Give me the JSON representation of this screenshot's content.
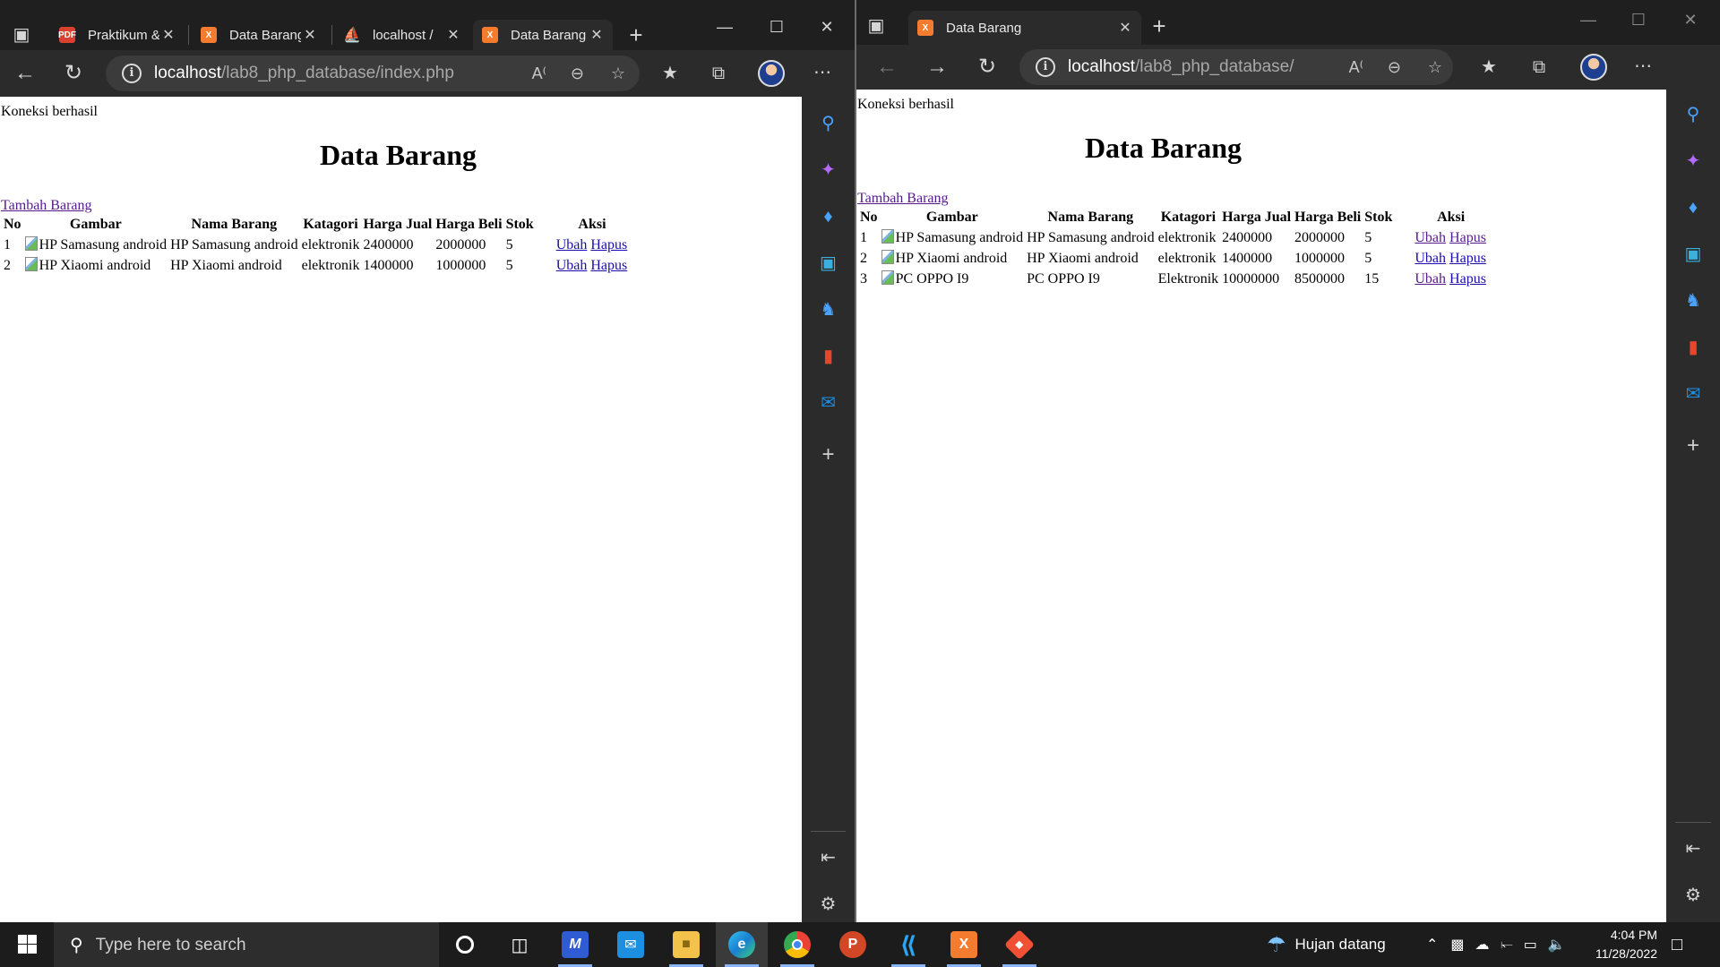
{
  "left_window": {
    "tabs": [
      {
        "label": "Praktikum &",
        "favicon": "pdf"
      },
      {
        "label": "Data Barang",
        "favicon": "xampp"
      },
      {
        "label": "localhost /",
        "favicon": "phpmyadmin"
      },
      {
        "label": "Data Barang",
        "favicon": "xampp"
      }
    ],
    "active_tab": 3,
    "url_host": "localhost",
    "url_path": "/lab8_php_database/index.php",
    "page": {
      "status": "Koneksi berhasil",
      "heading": "Data Barang",
      "add_link": "Tambah Barang",
      "columns": [
        "No",
        "Gambar",
        "Nama Barang",
        "Katagori",
        "Harga Jual",
        "Harga Beli",
        "Stok",
        "Aksi"
      ],
      "rows": [
        {
          "no": "1",
          "gambar": "HP Samasung android",
          "nama": "HP Samasung android",
          "kategori": "elektronik",
          "harga_jual": "2400000",
          "harga_beli": "2000000",
          "stok": "5",
          "ubah": "Ubah",
          "hapus": "Hapus"
        },
        {
          "no": "2",
          "gambar": "HP Xiaomi android",
          "nama": "HP Xiaomi android",
          "kategori": "elektronik",
          "harga_jual": "1400000",
          "harga_beli": "1000000",
          "stok": "5",
          "ubah": "Ubah",
          "hapus": "Hapus"
        }
      ]
    }
  },
  "right_window": {
    "tabs": [
      {
        "label": "Data Barang",
        "favicon": "xampp"
      }
    ],
    "url_host": "localhost",
    "url_path": "/lab8_php_database/",
    "page": {
      "status": "Koneksi berhasil",
      "heading": "Data Barang",
      "add_link": "Tambah Barang",
      "columns": [
        "No",
        "Gambar",
        "Nama Barang",
        "Katagori",
        "Harga Jual",
        "Harga Beli",
        "Stok",
        "Aksi"
      ],
      "rows": [
        {
          "no": "1",
          "gambar": "HP Samasung android",
          "nama": "HP Samasung android",
          "kategori": "elektronik",
          "harga_jual": "2400000",
          "harga_beli": "2000000",
          "stok": "5",
          "ubah": "Ubah",
          "hapus": "Hapus"
        },
        {
          "no": "2",
          "gambar": "HP Xiaomi android",
          "nama": "HP Xiaomi android",
          "kategori": "elektronik",
          "harga_jual": "1400000",
          "harga_beli": "1000000",
          "stok": "5",
          "ubah": "Ubah",
          "hapus": "Hapus"
        },
        {
          "no": "3",
          "gambar": "PC OPPO I9",
          "nama": "PC OPPO I9",
          "kategori": "Elektronik",
          "harga_jual": "10000000",
          "harga_beli": "8500000",
          "stok": "15",
          "ubah": "Ubah",
          "hapus": "Hapus"
        }
      ]
    }
  },
  "sidebar_icons": [
    "search-icon",
    "copilot-icon",
    "shopping-tag-icon",
    "tools-icon",
    "games-icon",
    "office-icon",
    "outlook-icon",
    "add-icon",
    "hide-sidebar-icon",
    "settings-icon"
  ],
  "taskbar": {
    "search_placeholder": "Type here to search",
    "apps": [
      "cortana",
      "task-view",
      "app-m",
      "mail",
      "file-explorer",
      "edge",
      "chrome",
      "powerpoint",
      "vscode",
      "xampp",
      "git"
    ],
    "weather": "Hujan datang",
    "time": "4:04 PM",
    "date": "11/28/2022"
  },
  "colors": {
    "link": "#1a0dab",
    "visited_link": "#551a8b",
    "chrome_dark": "#2b2b2b",
    "taskbar": "#1c1c1c"
  }
}
